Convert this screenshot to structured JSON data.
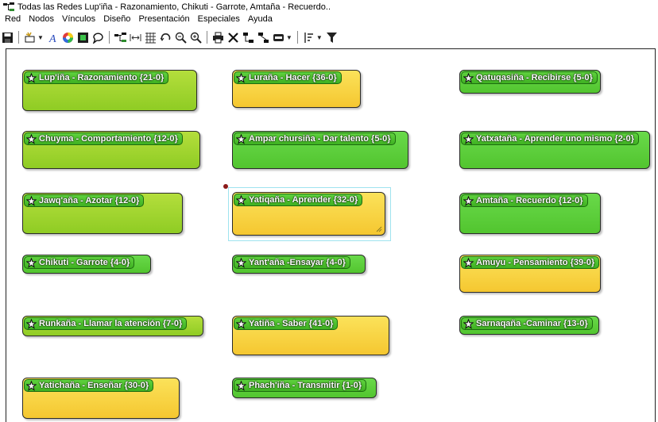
{
  "window": {
    "title": "Todas las Redes Lup'iña - Razonamiento, Chikuti - Garrote, Amtaña - Recuerdo.."
  },
  "menu": {
    "items": [
      "Red",
      "Nodos",
      "Vínculos",
      "Diseño",
      "Presentación",
      "Especiales",
      "Ayuda"
    ]
  },
  "toolbar": {
    "icons": [
      "save-icon",
      "new-node-icon",
      "font-icon",
      "color-wheel-icon",
      "color-box-icon",
      "comment-icon",
      "network-icon",
      "fit-width-icon",
      "grid-icon",
      "undo-icon",
      "zoom-out-icon",
      "zoom-in-icon",
      "print-icon",
      "delete-icon",
      "layout-icon",
      "layout-alt-icon",
      "card-icon",
      "sort-icon",
      "filter-icon"
    ]
  },
  "colors": {
    "green": "#5ccf3a",
    "lime": "#a3d632",
    "gold": "#f8d444",
    "selection": "#9fe3ef",
    "dot": "#8b1a1a"
  },
  "nodes": [
    {
      "label": "Lup'iña - Razonamiento {21-0}",
      "color": "lime"
    },
    {
      "label": "Luraña - Hacer {36-0}",
      "color": "gold"
    },
    {
      "label": "Qatuqasiña - Recibirse {5-0}",
      "color": "green"
    },
    {
      "label": "Chuyma - Comportamiento {12-0}",
      "color": "lime"
    },
    {
      "label": "Ampar chursiña - Dar talento {5-0}",
      "color": "green"
    },
    {
      "label": "Yatxataña - Aprender uno mismo {2-0}",
      "color": "green"
    },
    {
      "label": "Jawq'aña - Azotar {12-0}",
      "color": "lime"
    },
    {
      "label": "Yatiqaña - Aprender {32-0}",
      "color": "gold"
    },
    {
      "label": "Amtaña - Recuerdo {12-0}",
      "color": "green"
    },
    {
      "label": "Chikuti - Garrote {4-0}",
      "color": "green"
    },
    {
      "label": "Yant'aña -Ensayar {4-0}",
      "color": "green"
    },
    {
      "label": "Amuyu - Pensamiento {39-0}",
      "color": "gold"
    },
    {
      "label": "Runkaña - Llamar la atención {7-0}",
      "color": "lime"
    },
    {
      "label": "Yatiña - Saber {41-0}",
      "color": "gold"
    },
    {
      "label": "Sarnaqaña -Caminar {13-0}",
      "color": "green"
    },
    {
      "label": "Yatichaña - Enseñar {30-0}",
      "color": "gold"
    },
    {
      "label": "Phach'iña - Transmitir {1-0}",
      "color": "green"
    }
  ]
}
